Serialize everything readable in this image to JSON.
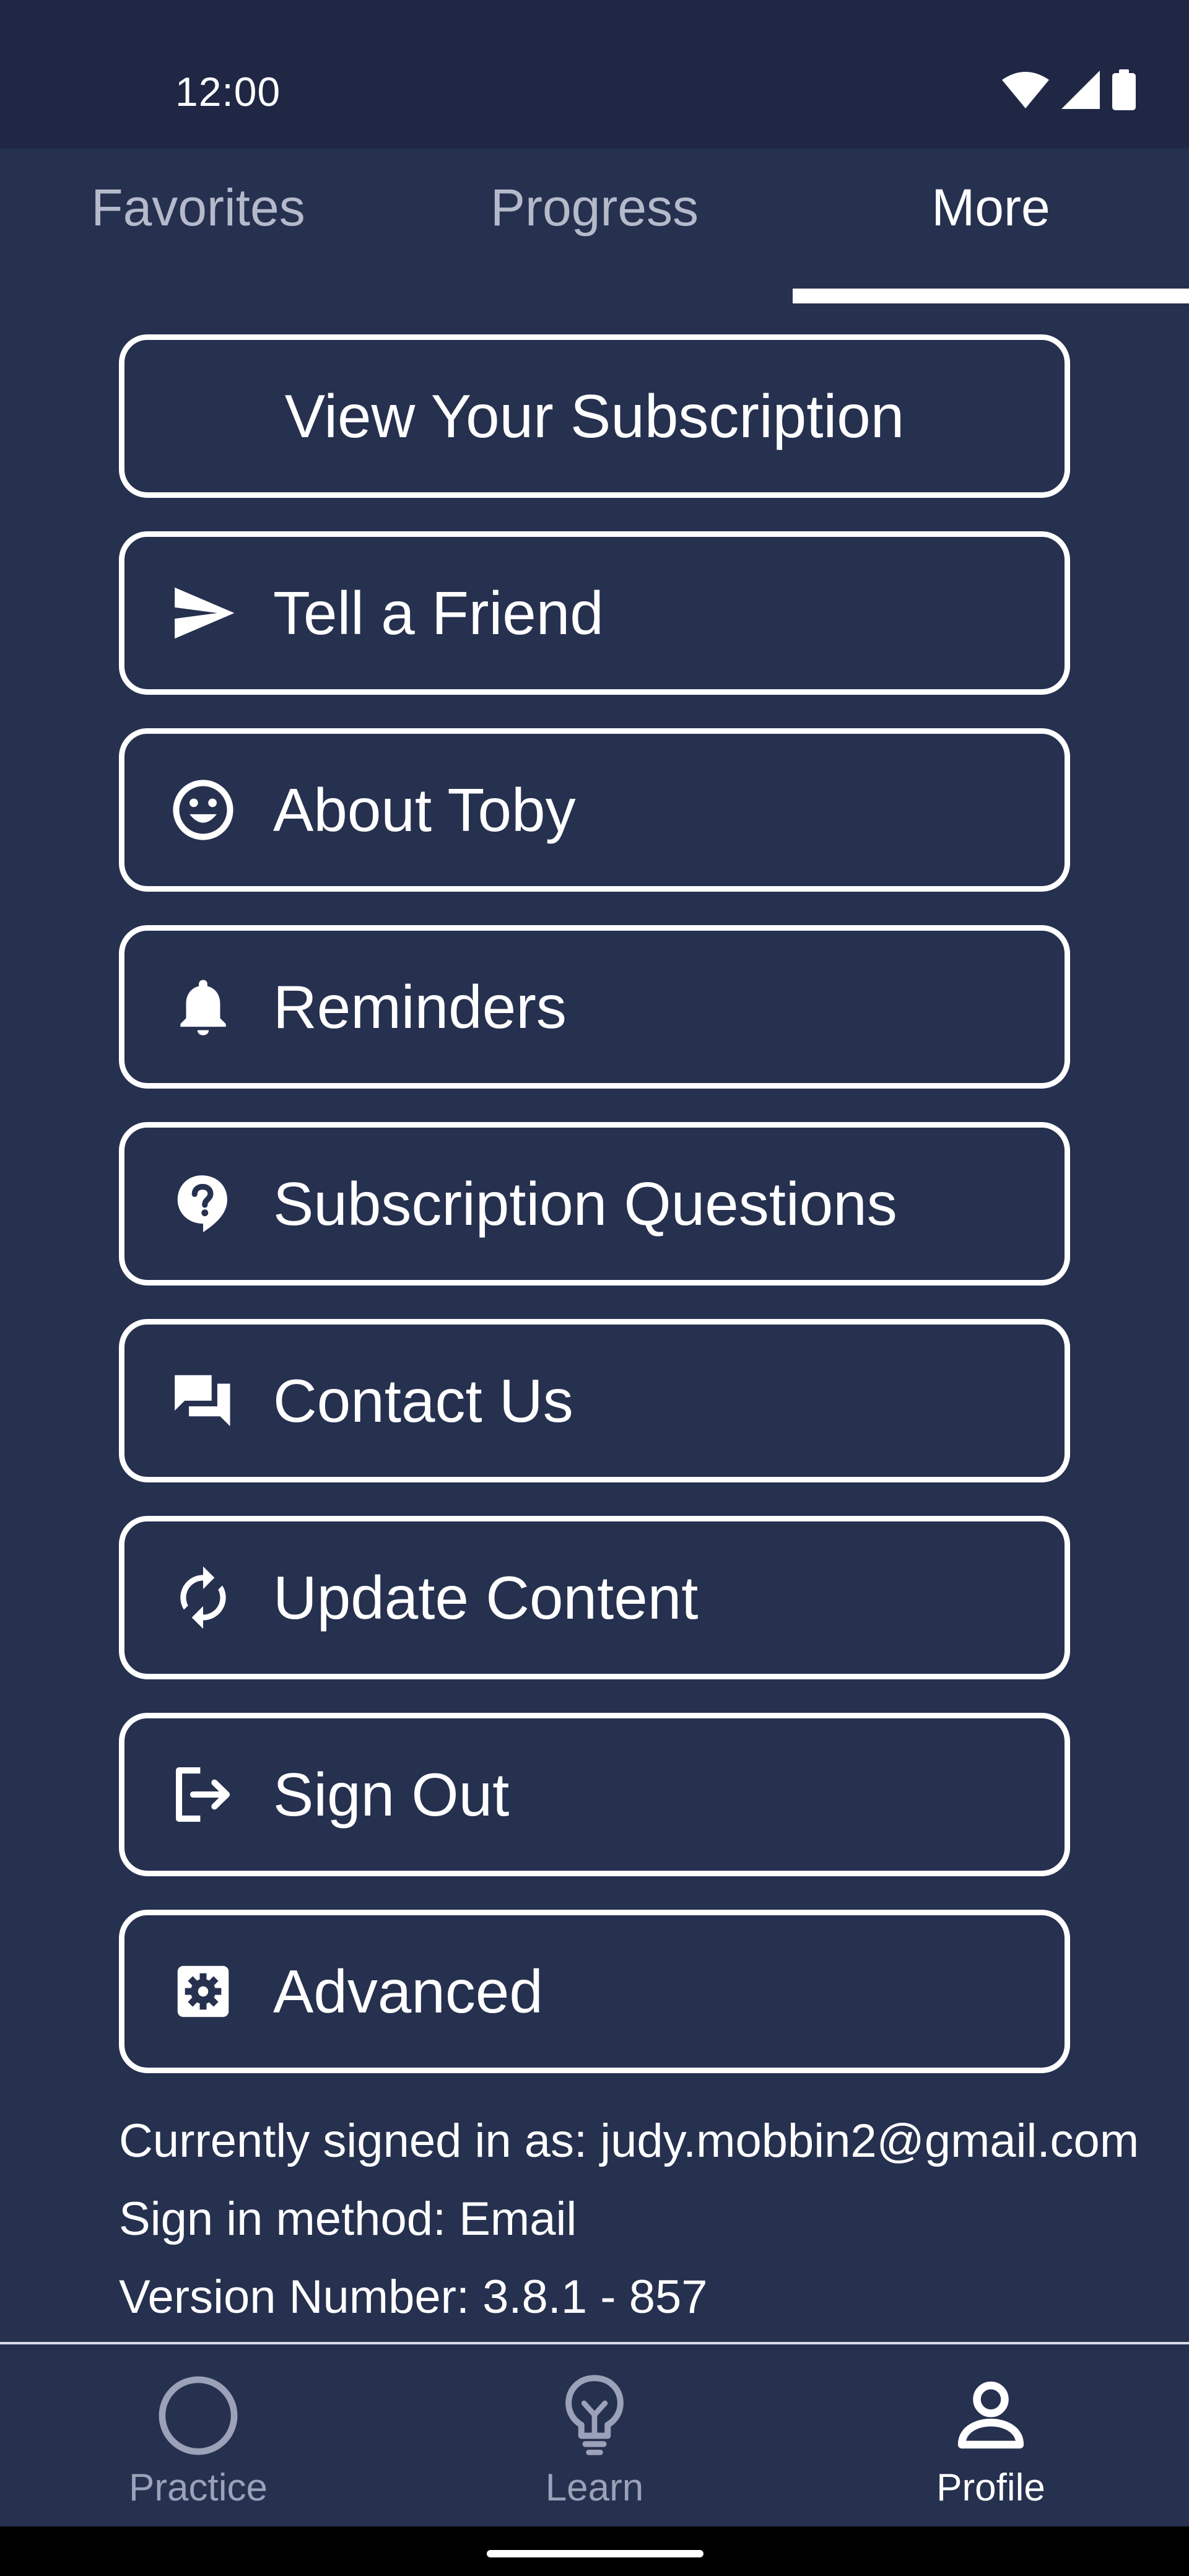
{
  "status_bar": {
    "time": "12:00",
    "icons": [
      "wifi-icon",
      "cellular-signal-icon",
      "battery-icon"
    ]
  },
  "top_tabs": [
    {
      "label": "Favorites",
      "active": false
    },
    {
      "label": "Progress",
      "active": false
    },
    {
      "label": "More",
      "active": true
    }
  ],
  "menu": {
    "view_subscription": "View Your Subscription",
    "tell_friend": "Tell a Friend",
    "about_toby": "About Toby",
    "reminders": "Reminders",
    "subscription_questions": "Subscription Questions",
    "contact_us": "Contact Us",
    "update_content": "Update Content",
    "sign_out": "Sign Out",
    "advanced": "Advanced"
  },
  "info": {
    "signed_in_as": "Currently signed in as: judy.mobbin2@gmail.com",
    "sign_in_method": "Sign in method: Email",
    "version": "Version Number: 3.8.1 - 857"
  },
  "bottom_nav": [
    {
      "label": "Practice",
      "icon": "circle-icon",
      "active": false
    },
    {
      "label": "Learn",
      "icon": "lightbulb-icon",
      "active": false
    },
    {
      "label": "Profile",
      "icon": "person-icon",
      "active": true
    }
  ],
  "colors": {
    "background": "#26304f",
    "status_bar": "#1f2744",
    "foreground": "#ffffff",
    "inactive_text": "#b5bacb",
    "inactive_nav": "#9aa1b8"
  }
}
